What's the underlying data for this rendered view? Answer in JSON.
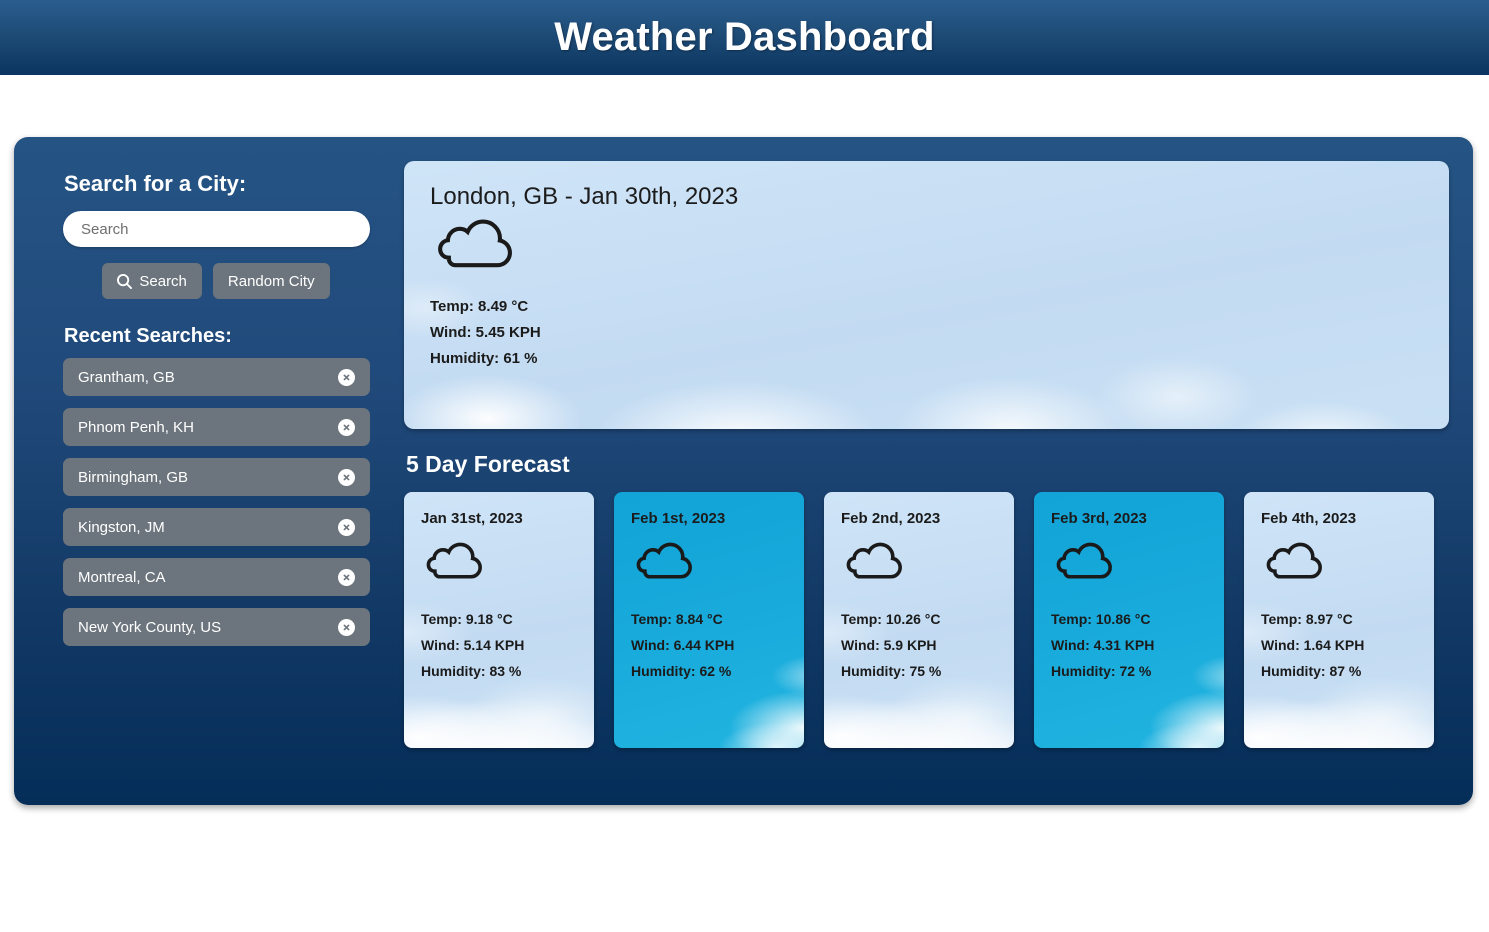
{
  "header": {
    "title": "Weather Dashboard"
  },
  "sidebar": {
    "search_heading": "Search for a City:",
    "search_placeholder": "Search",
    "search_value": "",
    "search_button_label": "Search",
    "random_button_label": "Random City",
    "recent_heading": "Recent Searches:",
    "recent_items": [
      {
        "label": "Grantham, GB"
      },
      {
        "label": "Phnom Penh, KH"
      },
      {
        "label": "Birmingham, GB"
      },
      {
        "label": "Kingston, JM"
      },
      {
        "label": "Montreal, CA"
      },
      {
        "label": "New York County, US"
      }
    ]
  },
  "current": {
    "title": "London, GB - Jan 30th, 2023",
    "icon": "cloud-icon",
    "temp": "Temp: 8.49 °C",
    "wind": "Wind: 5.45 KPH",
    "humidity": "Humidity: 61 %",
    "sky": "pale"
  },
  "forecast": {
    "heading": "5 Day Forecast",
    "days": [
      {
        "date": "Jan 31st, 2023",
        "icon": "cloud-icon",
        "temp": "Temp: 9.18 °C",
        "wind": "Wind: 5.14 KPH",
        "humidity": "Humidity: 83 %",
        "sky": "pale"
      },
      {
        "date": "Feb 1st, 2023",
        "icon": "cloud-icon",
        "temp": "Temp: 8.84 °C",
        "wind": "Wind: 6.44 KPH",
        "humidity": "Humidity: 62 %",
        "sky": "cyan"
      },
      {
        "date": "Feb 2nd, 2023",
        "icon": "cloud-icon",
        "temp": "Temp: 10.26 °C",
        "wind": "Wind: 5.9 KPH",
        "humidity": "Humidity: 75 %",
        "sky": "pale"
      },
      {
        "date": "Feb 3rd, 2023",
        "icon": "cloud-icon",
        "temp": "Temp: 10.86 °C",
        "wind": "Wind: 4.31 KPH",
        "humidity": "Humidity: 72 %",
        "sky": "cyan"
      },
      {
        "date": "Feb 4th, 2023",
        "icon": "cloud-icon",
        "temp": "Temp: 8.97 °C",
        "wind": "Wind: 1.64 KPH",
        "humidity": "Humidity: 87 %",
        "sky": "pale"
      }
    ]
  },
  "colors": {
    "header_top": "#2a5d8f",
    "header_bottom": "#0b3461",
    "panel_top": "#255484",
    "panel_bottom": "#042d58",
    "button_gray": "#6c757d",
    "sky_pale": "#c8dff4",
    "sky_cyan": "#17a8d9",
    "text_dark": "#1b1b1b",
    "text_light": "#ffffff"
  }
}
